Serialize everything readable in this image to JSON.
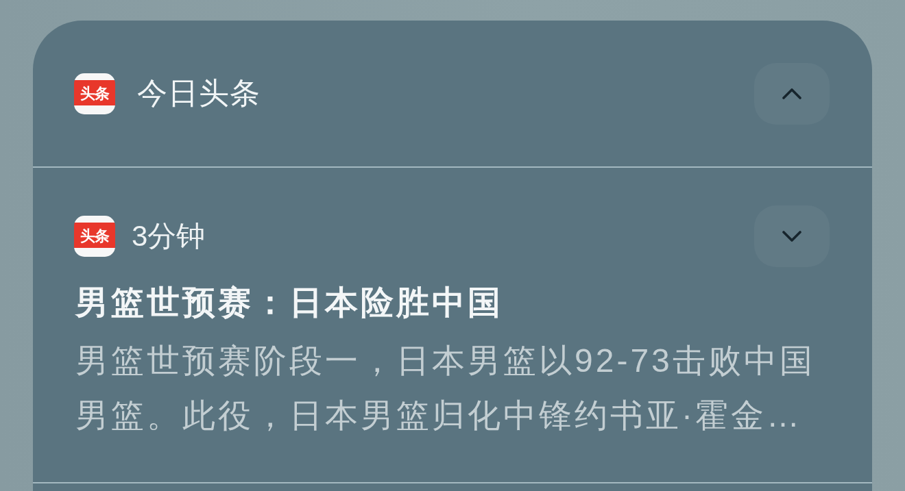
{
  "notification_group": {
    "app_icon_text": "头条",
    "app_name": "今日头条",
    "expanded": true,
    "notifications": [
      {
        "app_icon_text": "头条",
        "time": "3分钟",
        "expanded": false,
        "title": "男篮世预赛：日本险胜中国",
        "body": "男篮世预赛阶段一，日本男篮以92-73击败中国男篮。此役，日本男篮归化中锋约书亚·霍金…"
      }
    ]
  }
}
